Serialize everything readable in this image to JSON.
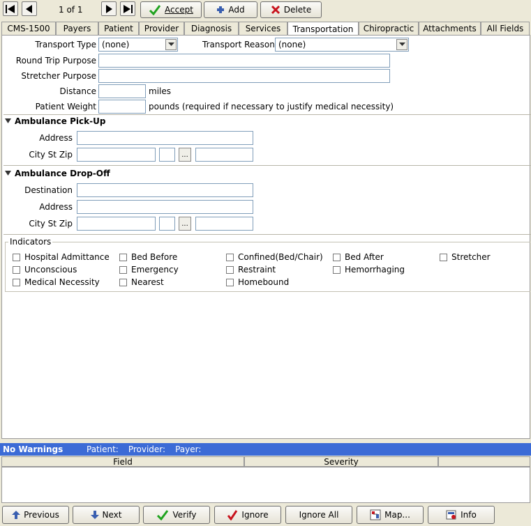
{
  "toolbar": {
    "record_counter": "1 of 1",
    "accept_label": "Accept",
    "add_label": "Add",
    "delete_label": "Delete"
  },
  "tabs": [
    {
      "label": "CMS-1500"
    },
    {
      "label": "Payers"
    },
    {
      "label": "Patient"
    },
    {
      "label": "Provider"
    },
    {
      "label": "Diagnosis"
    },
    {
      "label": "Services"
    },
    {
      "label": "Transportation",
      "active": true
    },
    {
      "label": "Chiropractic"
    },
    {
      "label": "Attachments"
    },
    {
      "label": "All Fields"
    }
  ],
  "transport": {
    "type_label": "Transport Type",
    "type_value": "(none)",
    "reason_label": "Transport Reason",
    "reason_value": "(none)",
    "round_trip_label": "Round Trip Purpose",
    "stretcher_label": "Stretcher Purpose",
    "distance_label": "Distance",
    "distance_unit": "miles",
    "weight_label": "Patient Weight",
    "weight_unit": "pounds (required if necessary to justify medical necessity)"
  },
  "pickup": {
    "title": "Ambulance Pick-Up",
    "address_label": "Address",
    "city_label": "City St Zip",
    "lookup_label": "..."
  },
  "dropoff": {
    "title": "Ambulance Drop-Off",
    "destination_label": "Destination",
    "address_label": "Address",
    "city_label": "City St Zip",
    "lookup_label": "..."
  },
  "indicators": {
    "title": "Indicators",
    "items": [
      "Hospital Admittance",
      "Bed Before",
      "Confined(Bed/Chair)",
      "Bed After",
      "Stretcher",
      "Unconscious",
      "Emergency",
      "Restraint",
      "Hemorrhaging",
      "Medical Necessity",
      "Nearest",
      "Homebound"
    ]
  },
  "warnings": {
    "title": "No Warnings",
    "patient_label": "Patient:",
    "provider_label": "Provider:",
    "payer_label": "Payer:",
    "col_field": "Field",
    "col_severity": "Severity"
  },
  "bottom": {
    "previous": "Previous",
    "next": "Next",
    "verify": "Verify",
    "ignore": "Ignore",
    "ignore_all": "Ignore All",
    "map": "Map...",
    "info": "Info"
  },
  "colors": {
    "warn_bar": "#3c6bd6",
    "accept_check": "#1fa31f",
    "delete_x": "#c8141e"
  }
}
